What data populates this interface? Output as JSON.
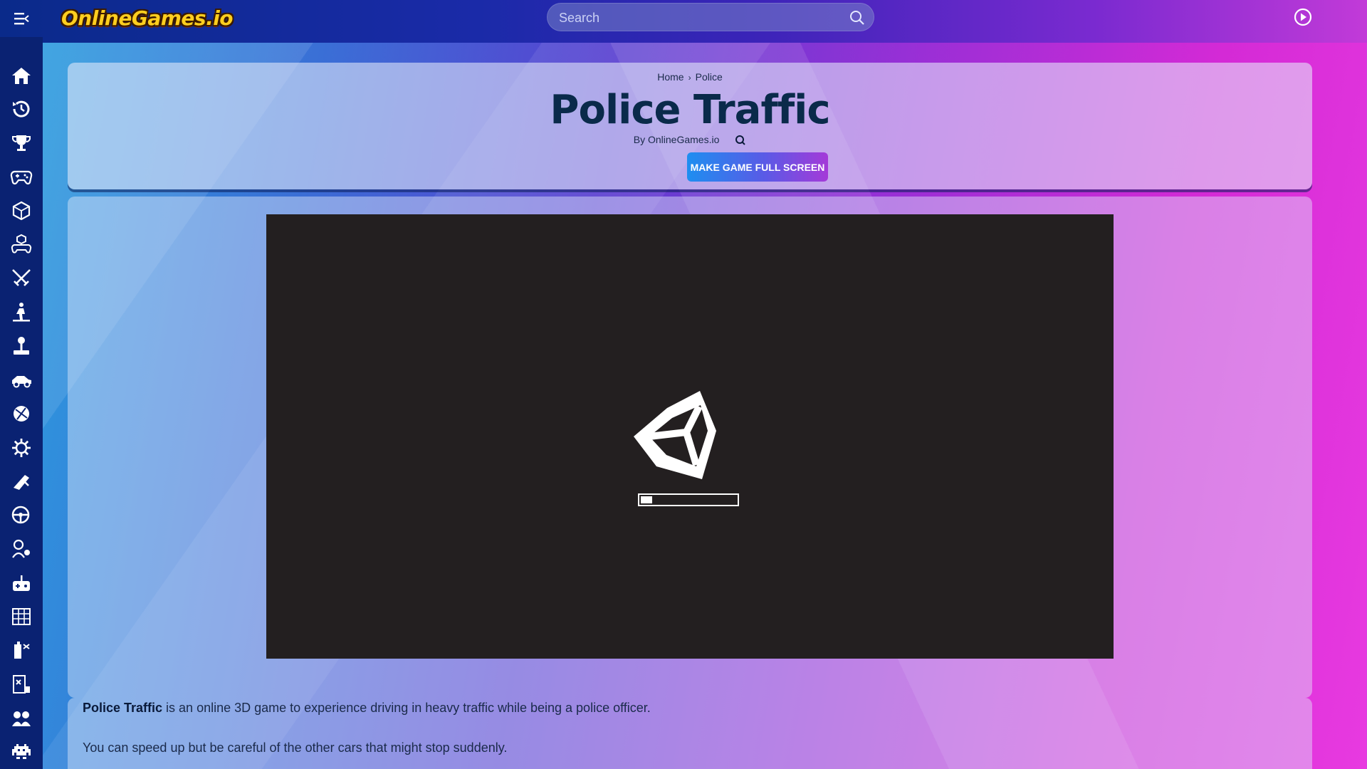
{
  "header": {
    "logo_text": "OnlineGames.io",
    "search_placeholder": "Search",
    "menu_icon": "menu-icon",
    "play_icon": "play-circle-icon"
  },
  "sidebar": {
    "items": [
      {
        "icon": "home-icon"
      },
      {
        "icon": "history-icon"
      },
      {
        "icon": "trophy-icon"
      },
      {
        "icon": "gamepad-icon"
      },
      {
        "icon": "dice-icon"
      },
      {
        "icon": "controller-icon"
      },
      {
        "icon": "crossed-swords-icon"
      },
      {
        "icon": "adventure-icon"
      },
      {
        "icon": "joystick-icon"
      },
      {
        "icon": "racing-icon"
      },
      {
        "icon": "sports-icon"
      },
      {
        "icon": "gear-icon"
      },
      {
        "icon": "shooter-icon"
      },
      {
        "icon": "steering-wheel-icon"
      },
      {
        "icon": "kids-icon"
      },
      {
        "icon": "arcade-icon"
      },
      {
        "icon": "building-icon"
      },
      {
        "icon": "puzzle-icon"
      },
      {
        "icon": "board-game-icon"
      },
      {
        "icon": "multiplayer-icon"
      },
      {
        "icon": "space-invader-icon"
      }
    ]
  },
  "breadcrumb": {
    "home": "Home",
    "separator": "›",
    "category": "Police"
  },
  "game": {
    "title": "Police Traffic",
    "byline": "By OnlineGames.io",
    "fullscreen_label": "MAKE GAME FULL SCREEN",
    "loading_progress": 0.12
  },
  "description": {
    "p1_bold": "Police Traffic",
    "p1_rest": " is an online 3D game to experience driving in heavy traffic while being a police officer.",
    "p2": "You can speed up but be careful of the other cars that might stop suddenly."
  },
  "colors": {
    "sidebar_bg": "#0a2272",
    "title_color": "#0a2a4a",
    "game_bg": "#231f20"
  }
}
